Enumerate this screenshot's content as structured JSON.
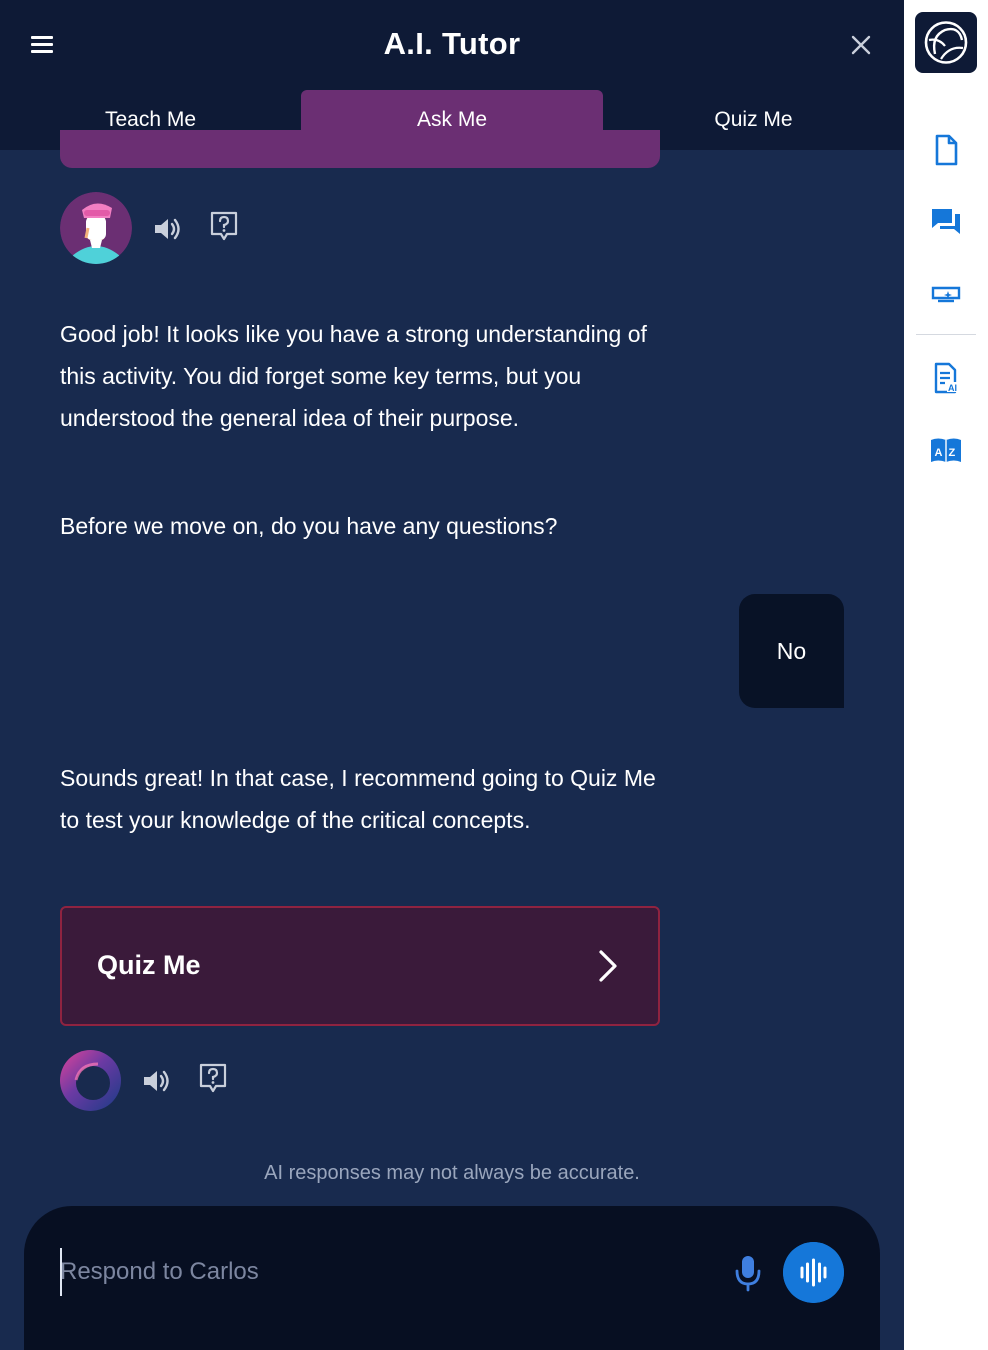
{
  "app": {
    "title": "A.I. Tutor"
  },
  "tabs": [
    {
      "label": "Teach Me",
      "active": false
    },
    {
      "label": "Ask Me",
      "active": true
    },
    {
      "label": "Quiz Me",
      "active": false
    }
  ],
  "colors": {
    "header_bg": "#0e1a36",
    "panel_bg": "#182a4e",
    "active_tab": "#6b2f73",
    "active_tab_underline": "#ea53b4",
    "user_bubble": "#081226",
    "quiz_card_bg": "#3a1a3a",
    "quiz_card_border": "#8f2340",
    "accent_blue": "#1577d9",
    "rail_icon": "#1577d9"
  },
  "messages": {
    "tutor_feedback": "Good job! It looks like you have a strong understanding of this activity. You did forget some key terms, but you understood the general idea of their purpose.",
    "tutor_question": "Before we move on, do you have any questions?",
    "user_reply": "No",
    "tutor_recommendation": "Sounds great! In that case, I recommend going to Quiz Me to test your knowledge of the critical concepts."
  },
  "quiz_card": {
    "label": "Quiz Me",
    "icon": "chevron-right-icon"
  },
  "disclaimer": "AI responses may not always be accurate.",
  "composer": {
    "placeholder": "Respond to Carlos",
    "value": ""
  },
  "icons": {
    "menu": "hamburger-menu-icon",
    "close": "close-icon",
    "speaker": "speaker-icon",
    "help": "question-bubble-icon",
    "mic": "microphone-icon",
    "voice": "voice-wave-icon"
  },
  "rail": {
    "items": [
      {
        "icon": "document-icon"
      },
      {
        "icon": "chat-icon"
      },
      {
        "icon": "screen-sparkle-icon"
      },
      {
        "icon": "ai-document-icon"
      },
      {
        "icon": "dictionary-icon"
      }
    ]
  }
}
